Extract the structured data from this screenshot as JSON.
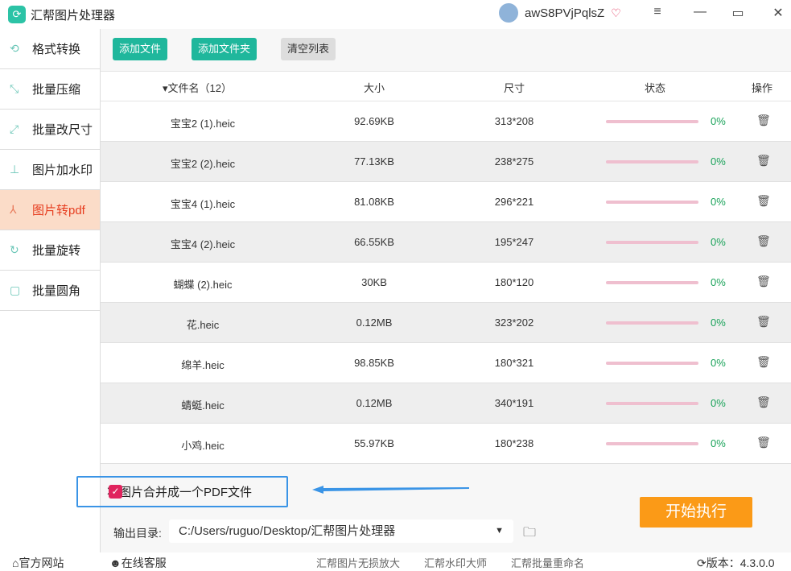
{
  "app": {
    "title": "汇帮图片处理器",
    "username": "awS8PVjPqlsZ"
  },
  "sidebar": {
    "items": [
      {
        "label": "格式转换",
        "icon": "convert-icon"
      },
      {
        "label": "批量压缩",
        "icon": "compress-icon"
      },
      {
        "label": "批量改尺寸",
        "icon": "resize-icon"
      },
      {
        "label": "图片加水印",
        "icon": "watermark-icon"
      },
      {
        "label": "图片转pdf",
        "icon": "pdf-icon",
        "active": true
      },
      {
        "label": "批量旋转",
        "icon": "rotate-icon"
      },
      {
        "label": "批量圆角",
        "icon": "round-corner-icon"
      }
    ]
  },
  "toolbar": {
    "add_file": "添加文件",
    "add_folder": "添加文件夹",
    "clear_list": "清空列表"
  },
  "table": {
    "headers": {
      "name": "▾文件名（12）",
      "size": "大小",
      "dim": "尺寸",
      "status": "状态",
      "action": "操作"
    },
    "rows": [
      {
        "name": "宝宝2 (1).heic",
        "size": "92.69KB",
        "dim": "313*208",
        "progress": "0%"
      },
      {
        "name": "宝宝2 (2).heic",
        "size": "77.13KB",
        "dim": "238*275",
        "progress": "0%"
      },
      {
        "name": "宝宝4 (1).heic",
        "size": "81.08KB",
        "dim": "296*221",
        "progress": "0%"
      },
      {
        "name": "宝宝4 (2).heic",
        "size": "66.55KB",
        "dim": "195*247",
        "progress": "0%"
      },
      {
        "name": "蝴蝶 (2).heic",
        "size": "30KB",
        "dim": "180*120",
        "progress": "0%"
      },
      {
        "name": "花.heic",
        "size": "0.12MB",
        "dim": "323*202",
        "progress": "0%"
      },
      {
        "name": "绵羊.heic",
        "size": "98.85KB",
        "dim": "180*321",
        "progress": "0%"
      },
      {
        "name": "蜻蜓.heic",
        "size": "0.12MB",
        "dim": "340*191",
        "progress": "0%"
      },
      {
        "name": "小鸡.heic",
        "size": "55.97KB",
        "dim": "180*238",
        "progress": "0%"
      }
    ]
  },
  "options": {
    "merge_label": "将图片合并成一个PDF文件",
    "merge_checked": true
  },
  "output": {
    "label": "输出目录:",
    "path": "C:/Users/ruguo/Desktop/汇帮图片处理器"
  },
  "start_button": "开始执行",
  "footer": {
    "website": "官方网站",
    "support": "在线客服",
    "link1": "汇帮图片无损放大",
    "link2": "汇帮水印大师",
    "link3": "汇帮批量重命名",
    "version": "版本：4.3.0.0"
  },
  "colors": {
    "accent": "#1fb79c",
    "start": "#fb9a17",
    "active_text": "#e63c1e"
  }
}
